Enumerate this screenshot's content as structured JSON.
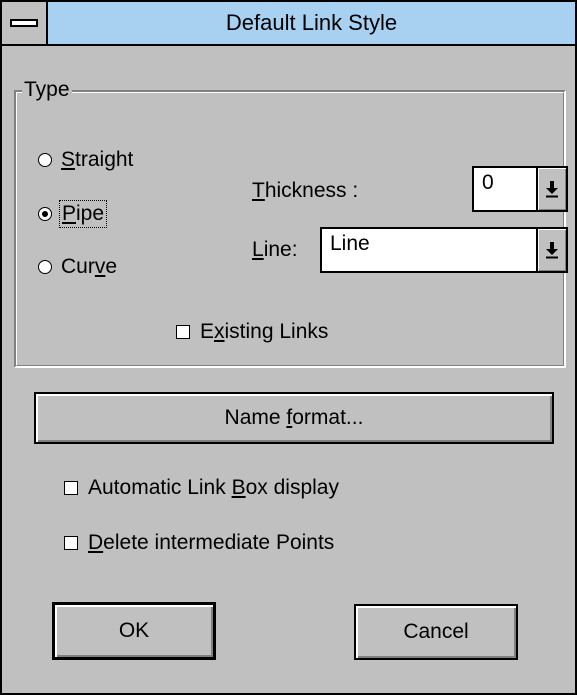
{
  "dialog": {
    "title": "Default Link Style"
  },
  "type_group": {
    "label": "Type",
    "radios": [
      {
        "label_pre": "",
        "label_key": "S",
        "label_post": "traight",
        "checked": false
      },
      {
        "label_pre": "",
        "label_key": "P",
        "label_post": "ipe",
        "checked": true
      },
      {
        "label_pre": "Cur",
        "label_key": "v",
        "label_post": "e",
        "checked": false
      }
    ],
    "thickness": {
      "label_key": "T",
      "label_post": "hickness :",
      "value": "0"
    },
    "line": {
      "label_key": "L",
      "label_post": "ine:",
      "value": "Line"
    },
    "existing_links": {
      "label_pre": "E",
      "label_key": "x",
      "label_post": "isting Links",
      "checked": false
    }
  },
  "name_format_button": {
    "label_pre": "Name ",
    "label_key": "f",
    "label_post": "ormat..."
  },
  "options": {
    "auto_link_box": {
      "label_pre": "Automatic Link ",
      "label_key": "B",
      "label_post": "ox display",
      "checked": false
    },
    "delete_points": {
      "label_pre": "",
      "label_key": "D",
      "label_post": "elete intermediate Points",
      "checked": false
    }
  },
  "buttons": {
    "ok_label": "OK",
    "cancel_label": "Cancel"
  },
  "icons": {
    "system_menu": "system-menu-icon",
    "dropdown": "dropdown-arrow-icon"
  },
  "colors": {
    "title_bar": "#a8d0f0",
    "face": "#c0c0c0"
  }
}
